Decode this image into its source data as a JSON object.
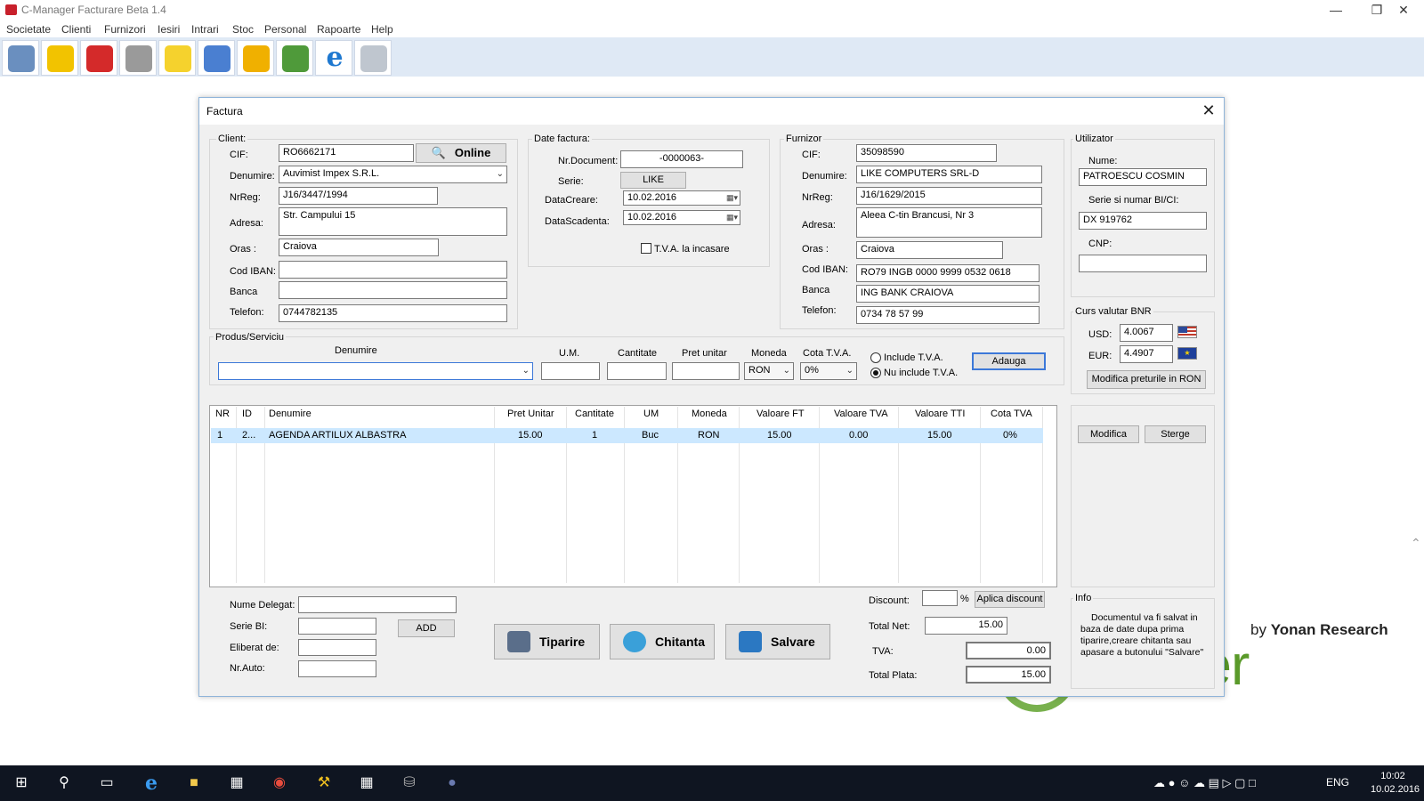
{
  "window": {
    "title": "C-Manager Facturare Beta 1.4"
  },
  "menu": [
    "Societate",
    "Clienti",
    "Furnizori",
    "Iesiri",
    "Intrari",
    "Stoc",
    "Personal",
    "Rapoarte",
    "Help"
  ],
  "toolbar_icons": [
    "users-icon",
    "download-arrow-icon",
    "folder-icon",
    "pen-icon",
    "notes-icon",
    "edit-pencil-icon",
    "return-arrow-icon",
    "money-icon",
    "internet-explorer-icon",
    "calculator-icon"
  ],
  "background": {
    "by": "by ",
    "brand": "Yonan Research",
    "logo_text": "anager"
  },
  "dialog": {
    "title": "Factura"
  },
  "client": {
    "group": "Client:",
    "cif_label": "CIF:",
    "cif": "RO6662171",
    "online_label": "Online",
    "denumire_label": "Denumire:",
    "denumire": "Auvimist Impex S.R.L.",
    "nrreg_label": "NrReg:",
    "nrreg": "J16/3447/1994",
    "adresa_label": "Adresa:",
    "adresa": "Str. Campului 15",
    "oras_label": "Oras :",
    "oras": "Craiova",
    "iban_label": "Cod IBAN:",
    "iban": "",
    "banca_label": "Banca",
    "banca": "",
    "telefon_label": "Telefon:",
    "telefon": "0744782135"
  },
  "factura": {
    "group": "Date factura:",
    "nrdoc_label": "Nr.Document:",
    "nrdoc": "-0000063-",
    "serie_label": "Serie:",
    "serie": "LIKE",
    "datacreare_label": "DataCreare:",
    "datacreare": "10.02.2016",
    "datascadenta_label": "DataScadenta:",
    "datascadenta": "10.02.2016",
    "tva_incasare": "T.V.A. la incasare"
  },
  "furnizor": {
    "group": "Furnizor",
    "cif_label": "CIF:",
    "cif": "35098590",
    "denumire_label": "Denumire:",
    "denumire": "LIKE COMPUTERS SRL-D",
    "nrreg_label": "NrReg:",
    "nrreg": "J16/1629/2015",
    "adresa_label": "Adresa:",
    "adresa": "Aleea C-tin Brancusi, Nr 3",
    "oras_label": "Oras :",
    "oras": "Craiova",
    "iban_label": "Cod IBAN:",
    "iban": "RO79 INGB 0000 9999 0532 0618",
    "banca_label": "Banca",
    "banca": "ING BANK CRAIOVA",
    "telefon_label": "Telefon:",
    "telefon": "0734 78 57 99"
  },
  "utilizator": {
    "group": "Utilizator",
    "nume_label": "Nume:",
    "nume": "PATROESCU COSMIN",
    "bi_label": "Serie si numar BI/CI:",
    "bi": "DX 919762",
    "cnp_label": "CNP:",
    "cnp": ""
  },
  "curs": {
    "group": "Curs valutar BNR",
    "usd_label": "USD:",
    "usd": "4.0067",
    "eur_label": "EUR:",
    "eur": "4.4907",
    "modifica_label": "Modifica preturile in RON"
  },
  "produs": {
    "group": "Produs/Serviciu",
    "denumire_label": "Denumire",
    "um_label": "U.M.",
    "cantitate_label": "Cantitate",
    "pret_label": "Pret unitar",
    "moneda_label": "Moneda",
    "moneda": "RON",
    "cota_label": "Cota T.V.A.",
    "cota": "0%",
    "include_tva": "Include T.V.A.",
    "nu_include_tva": "Nu include T.V.A.",
    "adauga_label": "Adauga"
  },
  "table": {
    "headers": [
      "NR",
      "ID",
      "Denumire",
      "Pret Unitar",
      "Cantitate",
      "UM",
      "Moneda",
      "Valoare FT",
      "Valoare TVA",
      "Valoare TTI",
      "Cota TVA"
    ],
    "rows": [
      [
        "1",
        "2...",
        "AGENDA ARTILUX ALBASTRA",
        "15.00",
        "1",
        "Buc",
        "RON",
        "15.00",
        "0.00",
        "15.00",
        "0%"
      ]
    ]
  },
  "actions": {
    "modifica": "Modifica",
    "sterge": "Sterge"
  },
  "delegat": {
    "nume_label": "Nume Delegat:",
    "seriebi_label": "Serie BI:",
    "add_label": "ADD",
    "eliberat_label": "Eliberat de:",
    "nrauto_label": "Nr.Auto:"
  },
  "buttons": {
    "tiparire": "Tiparire",
    "chitanta": "Chitanta",
    "salvare": "Salvare"
  },
  "totals": {
    "discount_label": "Discount:",
    "percent": "%",
    "aplica_label": "Aplica discount",
    "totalnet_label": "Total Net:",
    "totalnet": "15.00",
    "tva_label": "TVA:",
    "tva": "0.00",
    "totalplata_label": "Total Plata:",
    "totalplata": "15.00"
  },
  "info": {
    "group": "Info",
    "text": "Documentul va fi salvat in baza de date dupa prima tiparire,creare chitanta sau apasare a butonului \"Salvare\""
  },
  "taskbar": {
    "lang": "ENG",
    "time": "10:02",
    "date": "10.02.2016"
  }
}
